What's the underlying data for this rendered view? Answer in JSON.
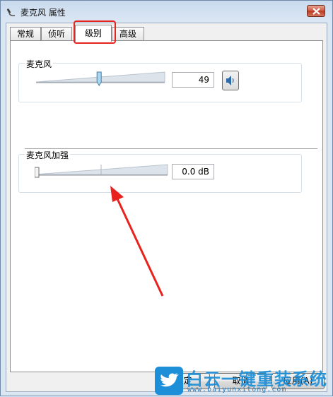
{
  "window": {
    "title": "麦克风 属性",
    "icons": {
      "title": "microphone-icon",
      "close": "close-icon"
    }
  },
  "tabs": [
    {
      "label": "常规",
      "active": false
    },
    {
      "label": "侦听",
      "active": false
    },
    {
      "label": "级别",
      "active": true
    },
    {
      "label": "高级",
      "active": false
    }
  ],
  "microphone": {
    "label": "麦克风",
    "value": "49",
    "level": 49,
    "icon": "speaker-icon"
  },
  "boost": {
    "label": "麦克风加强",
    "value": "0.0 dB",
    "level": 0
  },
  "buttons": {
    "ok": "确定",
    "cancel": "取消",
    "apply": "应用(A)"
  },
  "watermark": {
    "text": "白云一键重装系统",
    "url": "www.baiyunxitong.com",
    "icon": "twitter-bird-icon"
  },
  "annotation": {
    "color": "#e8231d"
  }
}
